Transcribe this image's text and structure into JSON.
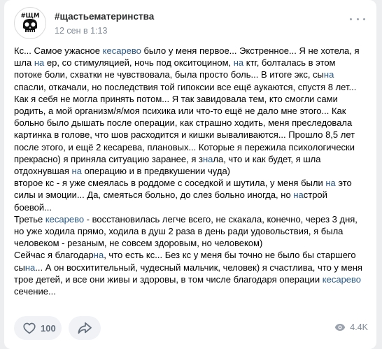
{
  "post": {
    "author": "#щастьематеринства",
    "date": "12 сен в 1:13",
    "paragraphs": [
      [
        {
          "t": "Кс... Самое ужасное "
        },
        {
          "t": "кесарево",
          "h": true
        },
        {
          "t": " было у меня первое... Экстренное... Я не хотела, я шла "
        },
        {
          "t": "на",
          "h": true
        },
        {
          "t": " ер, со стимуляцией, ночь под окситоцином, "
        },
        {
          "t": "на",
          "h": true
        },
        {
          "t": " ктг, болталась в этом потоке боли, схватки не чувствовала, была просто боль... В итоге экс, сы"
        },
        {
          "t": "на",
          "h": true
        },
        {
          "t": " спасли, откачали, но последствия той гипоксии все ещё аукаются, спустя 8 лет... Как я себя не могла принять потом... Я так завидовала тем, кто смогли сами родить, а мой организм/я/моя психика или что-то ещё не дало мне этого... Как больно было дышать после операции, как страшно ходить, меня преследовала картинка в голове, что шов расходится и кишки вываливаются... Прошло 8,5 лет после этого, и ещё 2 кесарева, плановых... Которые я пережила психологически прекрасно) я приняла ситуацию заранее, я з"
        },
        {
          "t": "на",
          "h": true
        },
        {
          "t": "ла, что и как будет, я шла отдохнувшая "
        },
        {
          "t": "на",
          "h": true
        },
        {
          "t": " операцию и в предвкушении чуда)"
        }
      ],
      [
        {
          "t": "второе кс - я уже смеялась в роддоме с соседкой и шутила, у меня были "
        },
        {
          "t": "на",
          "h": true
        },
        {
          "t": " это силы и эмоции... Да, смеяться больно, до слез больно иногда, но "
        },
        {
          "t": "на",
          "h": true
        },
        {
          "t": "строй боевой..."
        }
      ],
      [
        {
          "t": "Третье "
        },
        {
          "t": "кесарево",
          "h": true
        },
        {
          "t": " - восстановилась легче всего, не скакала, конечно, через 3 дня, но уже ходила прямо, ходила в душ 2 раза в день ради удовольствия, я была человеком - резаным, не совсем здоровым, но человеком)"
        }
      ],
      [
        {
          "t": "Сейчас я благодар"
        },
        {
          "t": "на",
          "h": true
        },
        {
          "t": ", что есть кс... Без кс у меня бы точно не было бы старшего сы"
        },
        {
          "t": "на",
          "h": true
        },
        {
          "t": "... А он восхитительный, чудесный мальчик, человек) я счастлива, что у меня трое детей, и все они живы и здоровы, в том числе благодаря операции "
        },
        {
          "t": "кесарево",
          "h": true
        },
        {
          "t": " сечение..."
        }
      ]
    ]
  },
  "footer": {
    "likes": "100",
    "views": "4.4K"
  },
  "icons": {
    "avatar": "skull-logo-icon",
    "more": "more-horizontal-icon",
    "like": "heart-icon",
    "share": "share-arrow-icon",
    "views": "eye-icon"
  },
  "colors": {
    "link": "#2a5885",
    "meta": "#818c99",
    "pill": "#f0f2f5"
  },
  "avatar_text": "#ЩМ"
}
